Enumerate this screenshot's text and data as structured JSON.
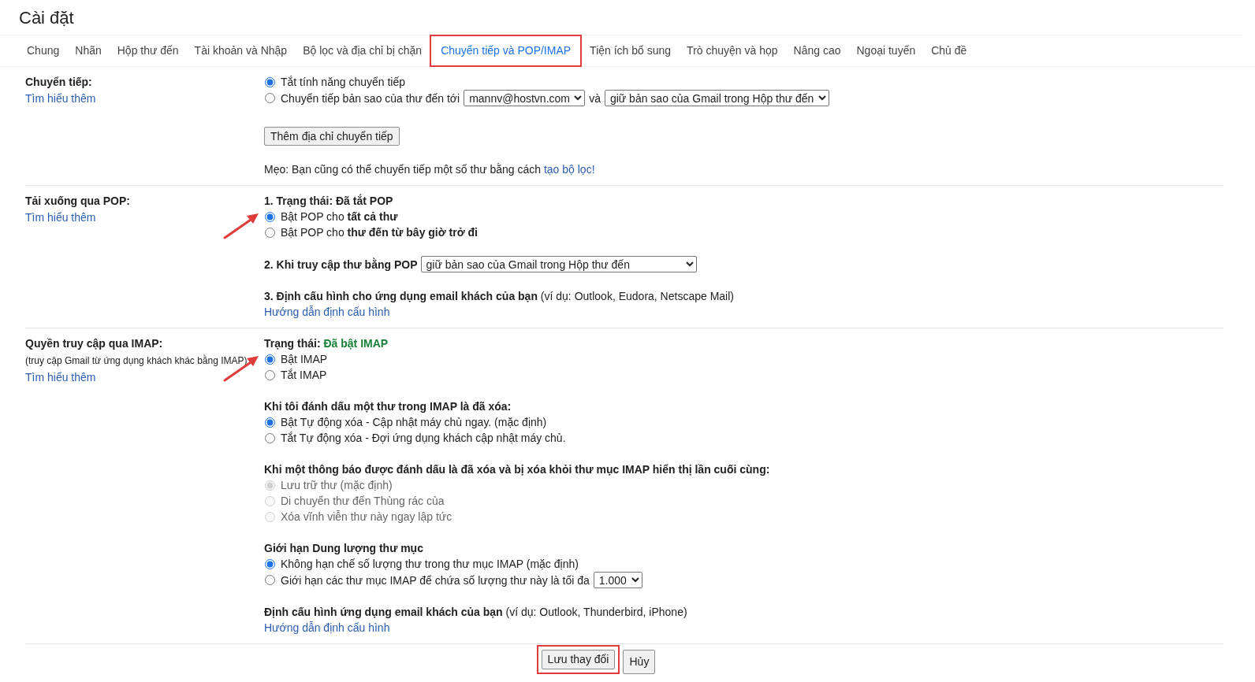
{
  "title": "Cài đặt",
  "tabs": [
    {
      "label": "Chung",
      "selected": false,
      "highlighted": false
    },
    {
      "label": "Nhãn",
      "selected": false,
      "highlighted": false
    },
    {
      "label": "Hộp thư đến",
      "selected": false,
      "highlighted": false
    },
    {
      "label": "Tài khoản và Nhập",
      "selected": false,
      "highlighted": false
    },
    {
      "label": "Bộ lọc và địa chỉ bị chặn",
      "selected": false,
      "highlighted": false
    },
    {
      "label": "Chuyển tiếp và POP/IMAP",
      "selected": true,
      "highlighted": true
    },
    {
      "label": "Tiện ích bổ sung",
      "selected": false,
      "highlighted": false
    },
    {
      "label": "Trò chuyện và họp",
      "selected": false,
      "highlighted": false
    },
    {
      "label": "Nâng cao",
      "selected": false,
      "highlighted": false
    },
    {
      "label": "Ngoại tuyến",
      "selected": false,
      "highlighted": false
    },
    {
      "label": "Chủ đề",
      "selected": false,
      "highlighted": false
    }
  ],
  "sections": [
    {
      "label": "Chuyển tiếp:",
      "learn_more": "Tìm hiểu thêm",
      "blocks": [
        {
          "kind": "radios",
          "options": [
            {
              "selected": true,
              "disabled": false,
              "pointer": false,
              "parts": [
                {
                  "kind": "text",
                  "text": "Tắt tính năng chuyển tiếp"
                }
              ]
            },
            {
              "selected": false,
              "disabled": false,
              "pointer": false,
              "parts": [
                {
                  "kind": "text",
                  "text": "Chuyển tiếp bản sao của thư đến tới"
                },
                {
                  "kind": "select",
                  "value": "mannv@hostvn.com"
                },
                {
                  "kind": "text",
                  "text": "và"
                },
                {
                  "kind": "select",
                  "value": "giữ bản sao của Gmail trong Hộp thư đến"
                }
              ]
            }
          ]
        },
        {
          "kind": "button",
          "label": "Thêm địa chỉ chuyển tiếp"
        },
        {
          "kind": "tip",
          "text": "Mẹo: Bạn cũng có thể chuyển tiếp một số thư bằng cách",
          "link": "tạo bộ lọc!"
        }
      ]
    },
    {
      "label": "Tải xuống qua POP:",
      "learn_more": "Tìm hiểu thêm",
      "blocks": [
        {
          "kind": "radios",
          "heading": "1. Trạng thái: Đã tắt POP",
          "options": [
            {
              "selected": true,
              "disabled": false,
              "pointer": true,
              "parts": [
                {
                  "kind": "text",
                  "text": "Bật POP cho **tất cả thư**"
                }
              ]
            },
            {
              "selected": false,
              "disabled": false,
              "pointer": false,
              "parts": [
                {
                  "kind": "text",
                  "text": "Bật POP cho **thư đến từ bây giờ trở đi**"
                }
              ]
            }
          ]
        },
        {
          "kind": "select_row",
          "label": "2. Khi truy cập thư bằng POP",
          "value": "giữ bản sao của Gmail trong Hộp thư đến"
        },
        {
          "kind": "config",
          "text": "**3. Định cấu hình cho ứng dụng email khách của bạn** (ví dụ: Outlook, Eudora, Netscape Mail)",
          "link": "Hướng dẫn định cấu hình"
        }
      ]
    },
    {
      "label": "Quyền truy cập qua IMAP:",
      "note": "(truy cập Gmail từ ứng dụng khách khác bằng IMAP)",
      "learn_more": "Tìm hiểu thêm",
      "blocks": [
        {
          "kind": "radios",
          "status_label": "Trạng thái:",
          "status_value": "Đã bật IMAP",
          "options": [
            {
              "selected": true,
              "disabled": false,
              "pointer": true,
              "parts": [
                {
                  "kind": "text",
                  "text": "Bật IMAP"
                }
              ]
            },
            {
              "selected": false,
              "disabled": false,
              "pointer": false,
              "parts": [
                {
                  "kind": "text",
                  "text": "Tắt IMAP"
                }
              ]
            }
          ]
        },
        {
          "kind": "radios",
          "heading": "Khi tôi đánh dấu một thư trong IMAP là đã xóa:",
          "options": [
            {
              "selected": true,
              "disabled": false,
              "pointer": false,
              "parts": [
                {
                  "kind": "text",
                  "text": "Bật Tự động xóa - Cập nhật máy chủ ngay. (mặc định)"
                }
              ]
            },
            {
              "selected": false,
              "disabled": false,
              "pointer": false,
              "parts": [
                {
                  "kind": "text",
                  "text": "Tắt Tự động xóa - Đợi ứng dụng khách cập nhật máy chủ."
                }
              ]
            }
          ]
        },
        {
          "kind": "radios",
          "heading": "Khi một thông báo được đánh dấu là đã xóa và bị xóa khỏi thư mục IMAP hiển thị lần cuối cùng:",
          "options": [
            {
              "selected": true,
              "disabled": true,
              "pointer": false,
              "parts": [
                {
                  "kind": "text",
                  "text": "Lưu trữ thư (mặc định)"
                }
              ]
            },
            {
              "selected": false,
              "disabled": true,
              "pointer": false,
              "parts": [
                {
                  "kind": "text",
                  "text": "Di chuyển thư đến Thùng rác của"
                }
              ]
            },
            {
              "selected": false,
              "disabled": true,
              "pointer": false,
              "parts": [
                {
                  "kind": "text",
                  "text": "Xóa vĩnh viễn thư này ngay lập tức"
                }
              ]
            }
          ]
        },
        {
          "kind": "radios",
          "heading": "Giới hạn Dung lượng thư mục",
          "options": [
            {
              "selected": true,
              "disabled": false,
              "pointer": false,
              "parts": [
                {
                  "kind": "text",
                  "text": "Không hạn chế số lượng thư trong thư mục IMAP (mặc định)"
                }
              ]
            },
            {
              "selected": false,
              "disabled": false,
              "pointer": false,
              "parts": [
                {
                  "kind": "text",
                  "text": "Giới hạn các thư mục IMAP để chứa số lượng thư này là tối đa"
                },
                {
                  "kind": "select",
                  "value": "1.000"
                }
              ]
            }
          ]
        },
        {
          "kind": "config",
          "text": "**Định cấu hình ứng dụng email khách của bạn** (ví dụ: Outlook, Thunderbird, iPhone)",
          "link": "Hướng dẫn định cấu hình"
        }
      ]
    }
  ],
  "buttons": [
    {
      "label": "Lưu thay đổi",
      "highlighted": true
    },
    {
      "label": "Hủy",
      "highlighted": false
    }
  ]
}
